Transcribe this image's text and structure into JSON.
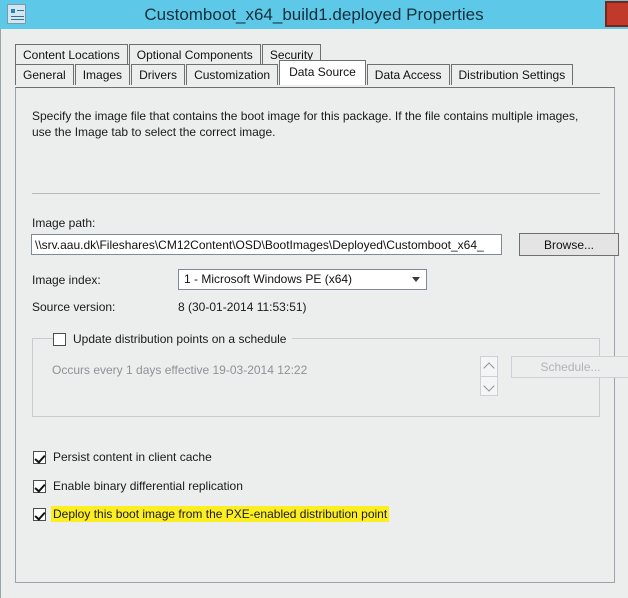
{
  "window": {
    "title": "Customboot_x64_build1.deployed Properties",
    "icon": "properties-document-icon",
    "close_label": "",
    "titlebar_color": "#5ec8e8",
    "close_color": "#c0392b"
  },
  "tabs": {
    "row_top": [
      {
        "label": "Content Locations",
        "selected": false
      },
      {
        "label": "Optional Components",
        "selected": false
      },
      {
        "label": "Security",
        "selected": false
      }
    ],
    "row_bottom": [
      {
        "label": "General",
        "selected": false
      },
      {
        "label": "Images",
        "selected": false
      },
      {
        "label": "Drivers",
        "selected": false
      },
      {
        "label": "Customization",
        "selected": false
      },
      {
        "label": "Data Source",
        "selected": true
      },
      {
        "label": "Data Access",
        "selected": false
      },
      {
        "label": "Distribution Settings",
        "selected": false
      }
    ]
  },
  "panel": {
    "description": "Specify the image file that contains the boot image for this package. If the file contains multiple images, use the Image tab to select the correct image.",
    "image_path": {
      "label": "Image path:",
      "value": "\\\\srv.aau.dk\\Fileshares\\CM12Content\\OSD\\BootImages\\Deployed\\Customboot_x64_",
      "browse_label": "Browse..."
    },
    "image_index": {
      "label": "Image index:",
      "value": "1 - Microsoft Windows PE (x64)",
      "options": [
        "1 - Microsoft Windows PE (x64)"
      ]
    },
    "source_version": {
      "label": "Source version:",
      "value": "8 (30-01-2014 11:53:51)"
    },
    "schedule_group": {
      "checkbox_label": "Update distribution points on a schedule",
      "checked": false,
      "occurs_text": "Occurs every 1 days effective 19-03-2014 12:22",
      "schedule_button_label": "Schedule...",
      "schedule_button_enabled": false
    },
    "options": [
      {
        "label": "Persist content in client cache",
        "checked": true,
        "highlighted": false
      },
      {
        "label": "Enable binary differential replication",
        "checked": true,
        "highlighted": false
      },
      {
        "label": "Deploy this boot image from the PXE-enabled distribution point",
        "checked": true,
        "highlighted": true,
        "highlight_color": "#fcee21"
      }
    ]
  }
}
